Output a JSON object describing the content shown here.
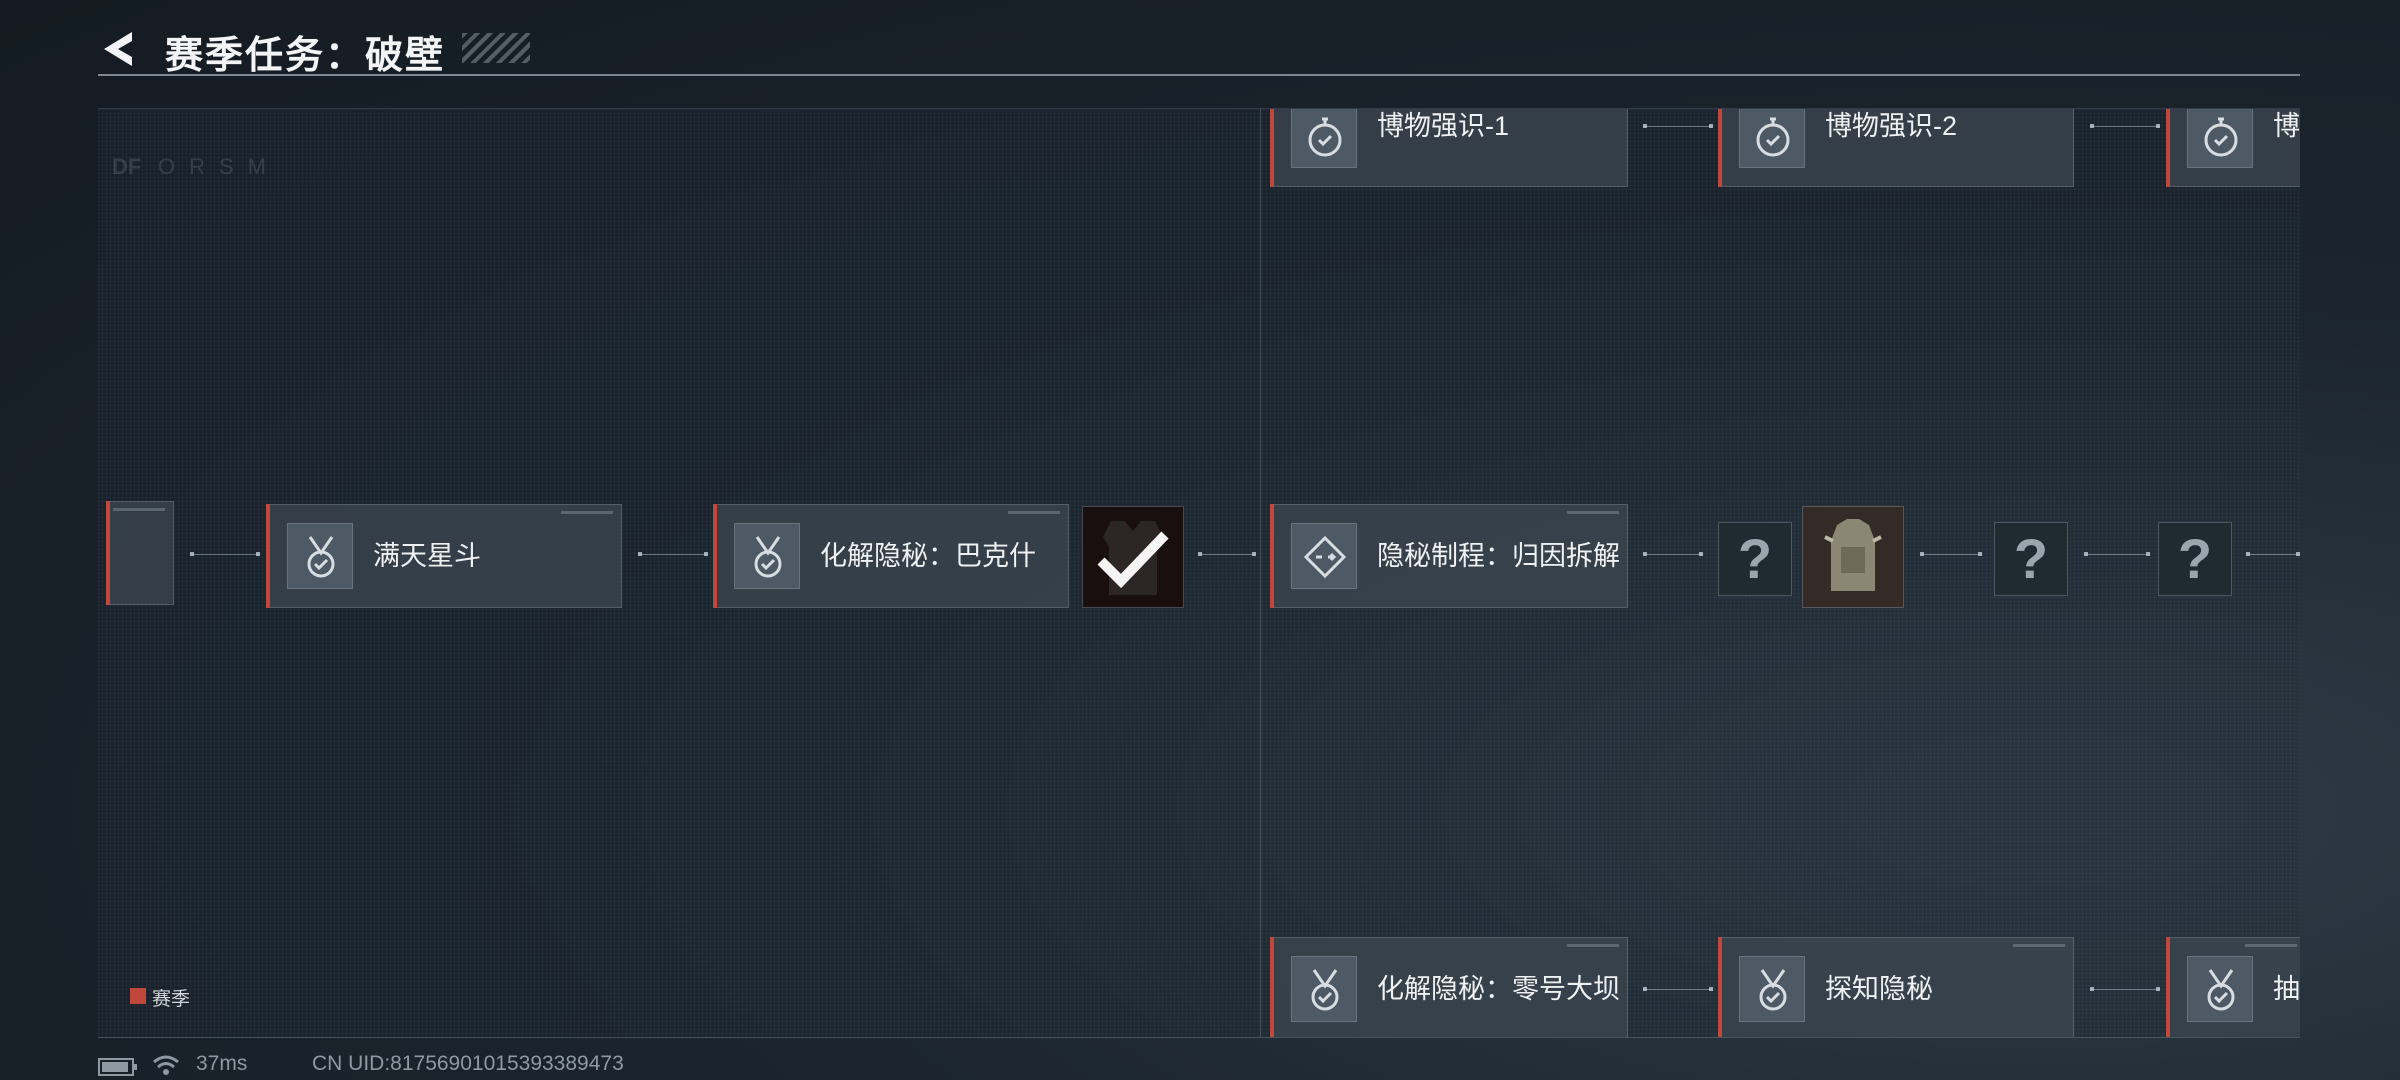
{
  "header": {
    "title": "赛季任务：破壁",
    "back_icon": "back-chevron-icon"
  },
  "board": {
    "faint_text": [
      "DF",
      "ORSM"
    ],
    "tasks": {
      "row_top": [
        {
          "label": "博物强识-1",
          "icon": "stopwatch-check-icon"
        },
        {
          "label": "博物强识-2",
          "icon": "stopwatch-check-icon"
        },
        {
          "label": "博",
          "icon": "stopwatch-check-icon"
        }
      ],
      "row_mid": [
        {
          "label": "满天星斗",
          "icon": "medal-check-icon"
        },
        {
          "label": "化解隐秘：巴克什",
          "icon": "medal-check-icon",
          "completed": true
        },
        {
          "label": "隐秘制程：归因拆解",
          "icon": "diamond-arrows-icon"
        }
      ],
      "row_bottom": [
        {
          "label": "化解隐秘：零号大坝",
          "icon": "medal-check-icon"
        },
        {
          "label": "探知隐秘",
          "icon": "medal-check-icon"
        },
        {
          "label": "抽",
          "icon": "medal-check-icon"
        }
      ]
    },
    "mystery_rewards": [
      "?",
      "?",
      "?"
    ],
    "reward_items": [
      "armor-vest-reward",
      "tactical-backpack-reward"
    ],
    "accent_color": "#c0473c"
  },
  "legend": {
    "label": "赛季",
    "color": "#c0473c"
  },
  "status": {
    "ping": "37ms",
    "uid": "CN UID:81756901015393389473",
    "icons": [
      "battery-icon",
      "wifi-icon"
    ]
  }
}
